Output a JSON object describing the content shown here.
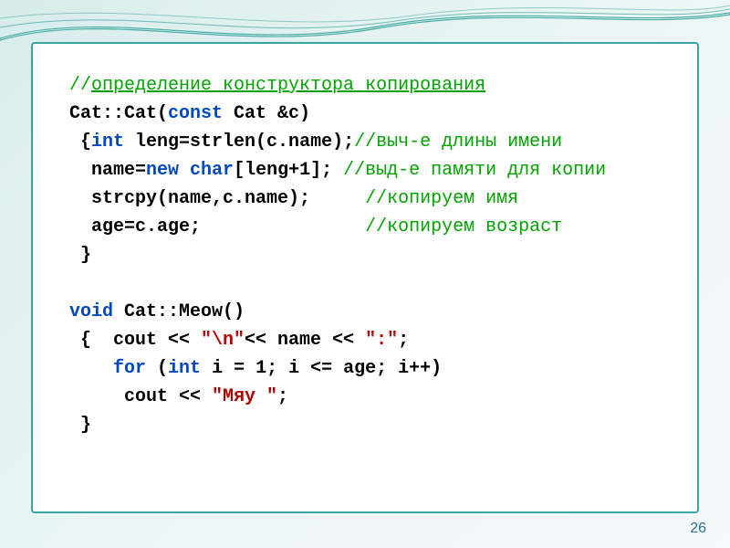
{
  "code": {
    "line1_pre": "//",
    "line1_txt": "определение конструктора копирования",
    "line2_a": "Cat::Cat(",
    "line2_kw": "const",
    "line2_b": " Cat &c)",
    "line3_a": " {",
    "line3_kw": "int",
    "line3_b": " leng=strlen(c.name);",
    "line3_cmt": "//выч-е длины имени",
    "line4_a": "  name=",
    "line4_kw1": "new",
    "line4_sp": " ",
    "line4_kw2": "char",
    "line4_b": "[leng+1]; ",
    "line4_cmt": "//выд-е памяти для копии",
    "line5_a": "  strcpy(name,c.name);     ",
    "line5_cmt": "//копируем имя",
    "line6_a": "  age=c.age;               ",
    "line6_cmt": "//копируем возраст",
    "line7": " }",
    "line9_kw": "void",
    "line9_b": " Cat::Meow()",
    "line10_a": " {  cout << ",
    "line10_s1": "\"\\n\"",
    "line10_mid": "<< name << ",
    "line10_s2": "\":\"",
    "line10_end": ";",
    "line11_pad": "    ",
    "line11_kw1": "for",
    "line11_a": " (",
    "line11_kw2": "int",
    "line11_b": " i = 1; i <= age; i++)",
    "line12_a": "     cout << ",
    "line12_s": "\"Мяу \"",
    "line12_end": ";",
    "line13": " }"
  },
  "pageNumber": "26"
}
